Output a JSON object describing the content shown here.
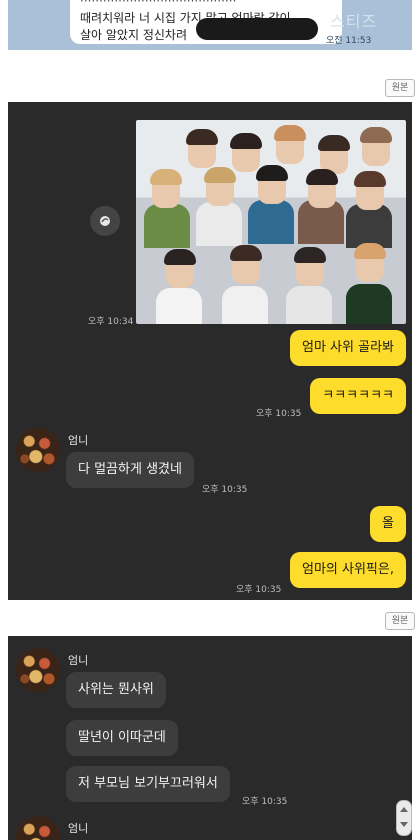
{
  "top_chat": {
    "lines": [
      "·········································",
      "때려치워라 너 시집 가지 말고 엄마랑 같이",
      "살아 알았지 정신차려"
    ],
    "watermark": "스티즈",
    "time": "오전 11:53"
  },
  "source_buttons": [
    "원본",
    "원본"
  ],
  "panel1": {
    "photo_time": "오후 10:34",
    "mine_1": "엄마 사위 골라봐",
    "mine_2": "ㅋㅋㅋㅋㅋㅋ",
    "mine_2_time": "오후 10:35",
    "other_name": "엄니",
    "other_1": "다 멀끔하게 생겼네",
    "other_1_time": "오후 10:35",
    "mine_3": "올",
    "mine_4": "엄마의 사위픽은,",
    "mine_4_time": "오후 10:35"
  },
  "panel2": {
    "other_name": "엄니",
    "messages": [
      "사위는 뭔사위",
      "딸년이 이따군데",
      "저 부모님 보기부끄러워서"
    ],
    "time": "오후 10:35",
    "other_name_2": "엄니"
  },
  "colors": {
    "chat_bg": "#2a2a2a",
    "my_bubble": "#fedc2c",
    "other_bubble": "#3d3d3d",
    "top_bg": "#a9c0d8"
  },
  "icons": [
    "share-icon",
    "scroll-up-icon",
    "scroll-down-icon"
  ]
}
